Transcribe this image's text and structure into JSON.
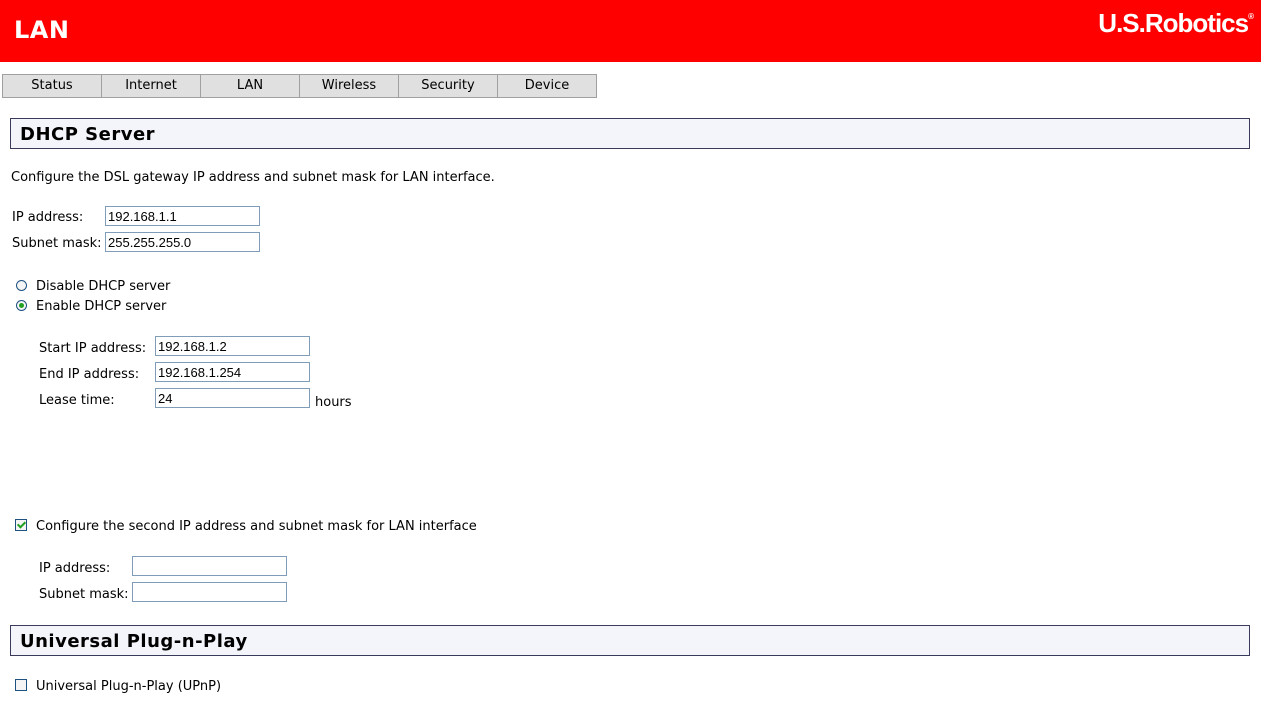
{
  "header": {
    "title": "LAN",
    "brand": "U.S.Robotics",
    "brand_mark": "®",
    "color": "#ff0000"
  },
  "tabs": [
    {
      "label": "Status"
    },
    {
      "label": "Internet"
    },
    {
      "label": "LAN"
    },
    {
      "label": "Wireless"
    },
    {
      "label": "Security"
    },
    {
      "label": "Device"
    }
  ],
  "dhcp": {
    "section_title": "DHCP Server",
    "description": "Configure the DSL gateway IP address and subnet mask for LAN interface.",
    "ip_label": "IP address:",
    "ip_value": "192.168.1.1",
    "mask_label": "Subnet mask:",
    "mask_value": "255.255.255.0",
    "disable_label": "Disable DHCP server",
    "enable_label": "Enable DHCP server",
    "selected": "enable",
    "start_label": "Start IP address:",
    "start_value": "192.168.1.2",
    "end_label": "End IP address:",
    "end_value": "192.168.1.254",
    "lease_label": "Lease time:",
    "lease_value": "24",
    "lease_unit": "hours"
  },
  "second_ip": {
    "checkbox_label": "Configure the second IP address and subnet mask for LAN interface",
    "checked": true,
    "ip_label": "IP address:",
    "ip_value": "",
    "mask_label": "Subnet mask:",
    "mask_value": ""
  },
  "upnp": {
    "section_title": "Universal Plug-n-Play",
    "checkbox_label": "Universal Plug-n-Play (UPnP)",
    "checked": false
  }
}
